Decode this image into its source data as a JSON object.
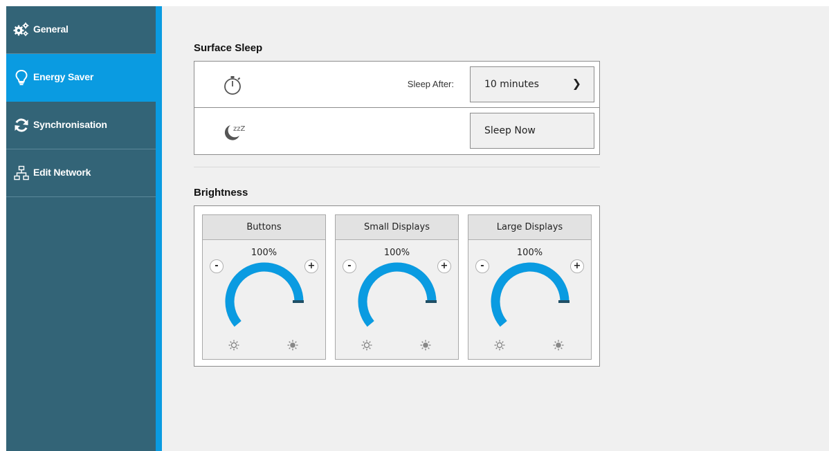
{
  "sidebar": {
    "items": [
      {
        "label": "General",
        "icon": "gears-icon"
      },
      {
        "label": "Energy Saver",
        "icon": "lightbulb-icon",
        "active": true
      },
      {
        "label": "Synchronisation",
        "icon": "sync-icon"
      },
      {
        "label": "Edit Network",
        "icon": "network-icon"
      }
    ]
  },
  "surface_sleep": {
    "title": "Surface Sleep",
    "sleep_after_label": "Sleep After:",
    "sleep_after_value": "10 minutes",
    "sleep_now_label": "Sleep Now",
    "timer_icon": "stopwatch-icon",
    "sleep_icon": "moon-zzz-icon",
    "zzz_text": "zzZ"
  },
  "brightness": {
    "title": "Brightness",
    "panels": [
      {
        "label": "Buttons",
        "value": "100%",
        "level": 1.0
      },
      {
        "label": "Small Displays",
        "value": "100%",
        "level": 1.0
      },
      {
        "label": "Large Displays",
        "value": "100%",
        "level": 1.0
      }
    ],
    "minus_label": "-",
    "plus_label": "+"
  },
  "colors": {
    "sidebar_bg": "#336477",
    "accent": "#0a9be1",
    "background": "#f0f0f0",
    "dial_track": "#cccccc",
    "dial_fill": "#0a9be1",
    "dial_cap": "#1f4f66"
  }
}
